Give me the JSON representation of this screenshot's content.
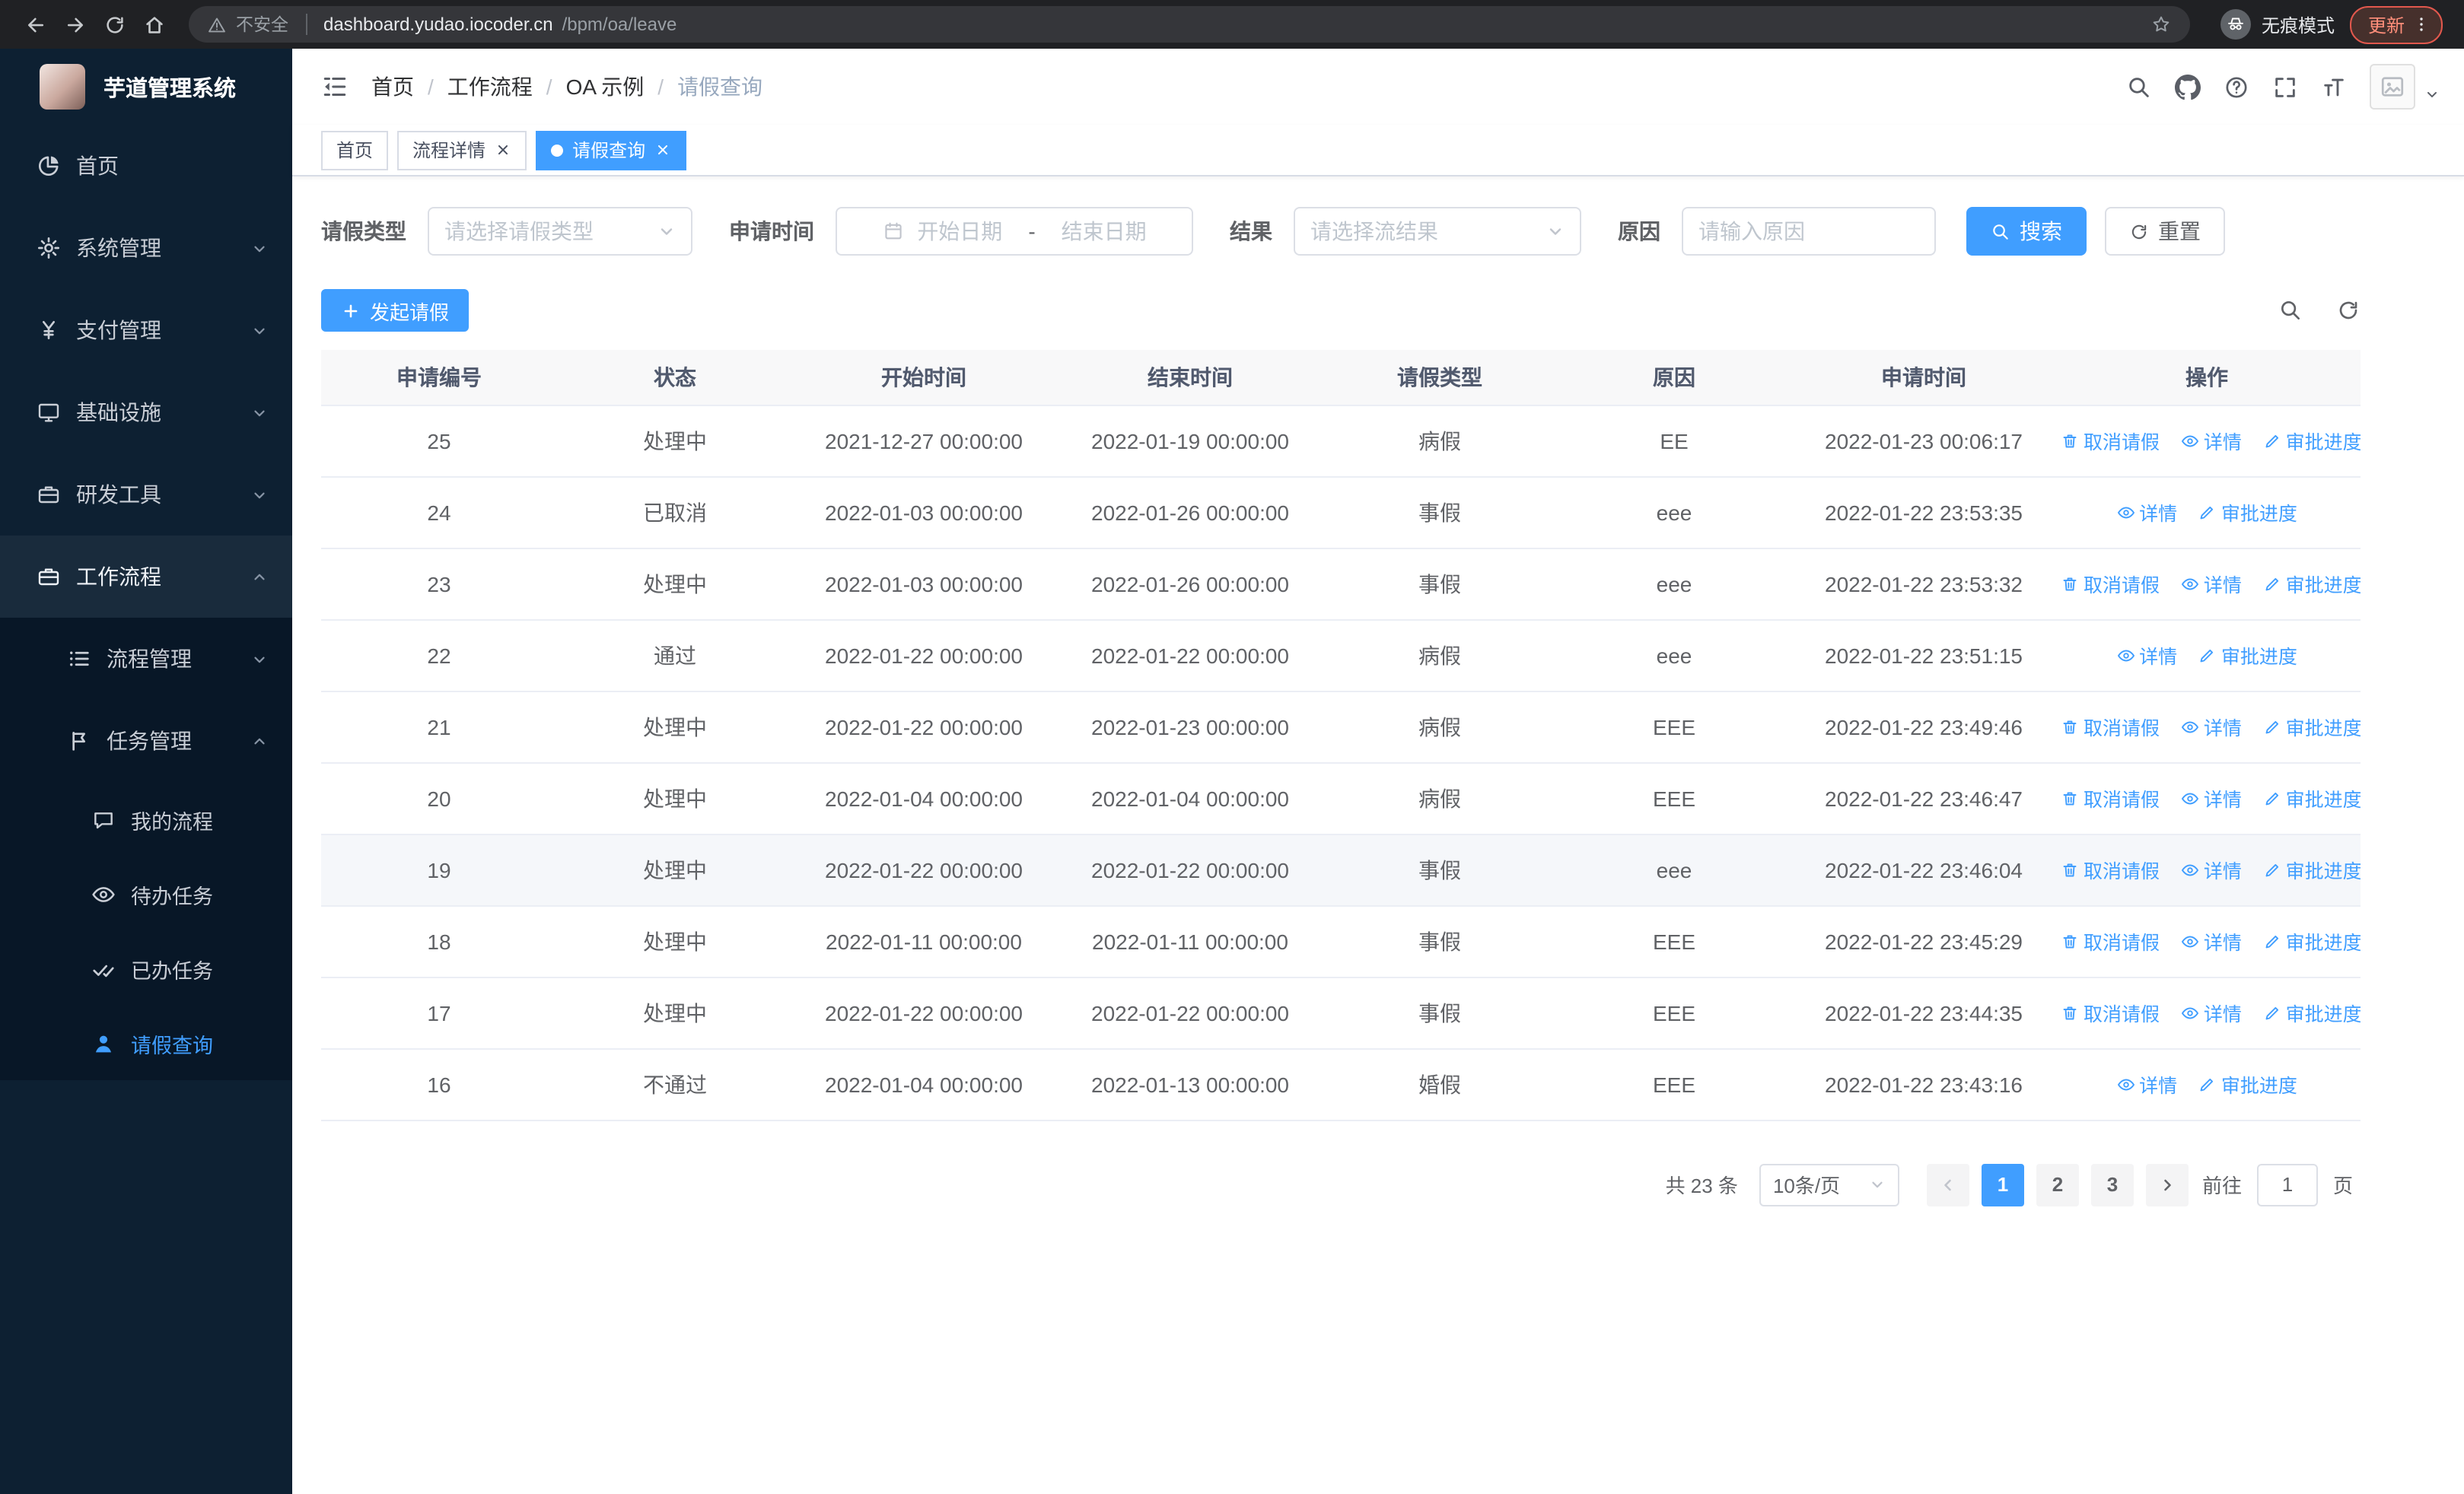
{
  "accent": "#409eff",
  "browser": {
    "security_label": "不安全",
    "url_host": "dashboard.yudao.iocoder.cn",
    "url_path": "/bpm/oa/leave",
    "incognito_label": "无痕模式",
    "update_label": "更新"
  },
  "sidebar": {
    "logo_title": "芋道管理系统",
    "items": [
      {
        "label": "首页",
        "icon": "dashboard-icon"
      },
      {
        "label": "系统管理",
        "icon": "gear-icon"
      },
      {
        "label": "支付管理",
        "icon": "yen-icon"
      },
      {
        "label": "基础设施",
        "icon": "monitor-icon"
      },
      {
        "label": "研发工具",
        "icon": "toolbox-icon"
      },
      {
        "label": "工作流程",
        "icon": "briefcase-icon"
      },
      {
        "label": "流程管理",
        "icon": "list-icon"
      },
      {
        "label": "任务管理",
        "icon": "flag-icon"
      },
      {
        "label": "我的流程",
        "icon": "chat-icon"
      },
      {
        "label": "待办任务",
        "icon": "eye-icon"
      },
      {
        "label": "已办任务",
        "icon": "double-check-icon"
      },
      {
        "label": "请假查询",
        "icon": "user-icon"
      }
    ]
  },
  "navbar": {
    "separator": "/",
    "breadcrumb": [
      {
        "label": "首页"
      },
      {
        "label": "工作流程"
      },
      {
        "label": "OA 示例"
      },
      {
        "label": "请假查询"
      }
    ]
  },
  "tabs": [
    {
      "label": "首页"
    },
    {
      "label": "流程详情"
    },
    {
      "label": "请假查询"
    }
  ],
  "filters": {
    "leave_type_label": "请假类型",
    "leave_type_placeholder": "请选择请假类型",
    "apply_time_label": "申请时间",
    "start_date_placeholder": "开始日期",
    "range_separator": "-",
    "end_date_placeholder": "结束日期",
    "result_label": "结果",
    "result_placeholder": "请选择流结果",
    "reason_label": "原因",
    "reason_placeholder": "请输入原因",
    "search_button": "搜索",
    "reset_button": "重置"
  },
  "toolbar": {
    "create_label": "发起请假"
  },
  "table": {
    "columns": [
      "申请编号",
      "状态",
      "开始时间",
      "结束时间",
      "请假类型",
      "原因",
      "申请时间",
      "操作"
    ],
    "actions": {
      "cancel": "取消请假",
      "detail": "详情",
      "progress": "审批进度"
    },
    "rows": [
      {
        "id": "25",
        "status": "处理中",
        "start": "2021-12-27 00:00:00",
        "end": "2022-01-19 00:00:00",
        "type": "病假",
        "reason": "EE",
        "applied": "2022-01-23 00:06:17"
      },
      {
        "id": "24",
        "status": "已取消",
        "start": "2022-01-03 00:00:00",
        "end": "2022-01-26 00:00:00",
        "type": "事假",
        "reason": "eee",
        "applied": "2022-01-22 23:53:35"
      },
      {
        "id": "23",
        "status": "处理中",
        "start": "2022-01-03 00:00:00",
        "end": "2022-01-26 00:00:00",
        "type": "事假",
        "reason": "eee",
        "applied": "2022-01-22 23:53:32"
      },
      {
        "id": "22",
        "status": "通过",
        "start": "2022-01-22 00:00:00",
        "end": "2022-01-22 00:00:00",
        "type": "病假",
        "reason": "eee",
        "applied": "2022-01-22 23:51:15"
      },
      {
        "id": "21",
        "status": "处理中",
        "start": "2022-01-22 00:00:00",
        "end": "2022-01-23 00:00:00",
        "type": "病假",
        "reason": "EEE",
        "applied": "2022-01-22 23:49:46"
      },
      {
        "id": "20",
        "status": "处理中",
        "start": "2022-01-04 00:00:00",
        "end": "2022-01-04 00:00:00",
        "type": "病假",
        "reason": "EEE",
        "applied": "2022-01-22 23:46:47"
      },
      {
        "id": "19",
        "status": "处理中",
        "start": "2022-01-22 00:00:00",
        "end": "2022-01-22 00:00:00",
        "type": "事假",
        "reason": "eee",
        "applied": "2022-01-22 23:46:04"
      },
      {
        "id": "18",
        "status": "处理中",
        "start": "2022-01-11 00:00:00",
        "end": "2022-01-11 00:00:00",
        "type": "事假",
        "reason": "EEE",
        "applied": "2022-01-22 23:45:29"
      },
      {
        "id": "17",
        "status": "处理中",
        "start": "2022-01-22 00:00:00",
        "end": "2022-01-22 00:00:00",
        "type": "事假",
        "reason": "EEE",
        "applied": "2022-01-22 23:44:35"
      },
      {
        "id": "16",
        "status": "不通过",
        "start": "2022-01-04 00:00:00",
        "end": "2022-01-13 00:00:00",
        "type": "婚假",
        "reason": "EEE",
        "applied": "2022-01-22 23:43:16"
      }
    ]
  },
  "pagination": {
    "total": "共 23 条",
    "page_size": "10条/页",
    "pages": [
      "1",
      "2",
      "3"
    ],
    "goto_label": "前往",
    "goto_value": "1",
    "unit_label": "页"
  }
}
